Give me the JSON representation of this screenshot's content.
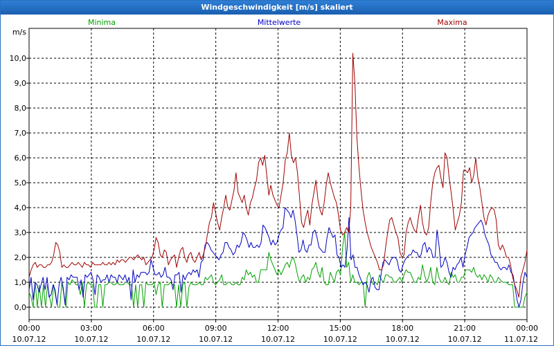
{
  "window": {
    "title": "Windgeschwindigkeit [m/s] skaliert"
  },
  "chart_data": {
    "type": "line",
    "title": "Windgeschwindigkeit [m/s] skaliert",
    "ylabel": "m/s",
    "ylim": [
      -0.5,
      11.2
    ],
    "yticks": [
      "0,0",
      "1,0",
      "2,0",
      "3,0",
      "4,0",
      "5,0",
      "6,0",
      "7,0",
      "8,0",
      "9,0",
      "10,0"
    ],
    "xlim": [
      0,
      24
    ],
    "xticks": [
      {
        "time": "00:00",
        "date": "10.07.12"
      },
      {
        "time": "03:00",
        "date": "10.07.12"
      },
      {
        "time": "06:00",
        "date": "10.07.12"
      },
      {
        "time": "09:00",
        "date": "10.07.12"
      },
      {
        "time": "12:00",
        "date": "10.07.12"
      },
      {
        "time": "15:00",
        "date": "10.07.12"
      },
      {
        "time": "18:00",
        "date": "10.07.12"
      },
      {
        "time": "21:00",
        "date": "10.07.12"
      },
      {
        "time": "00:00",
        "date": "11.07.12"
      }
    ],
    "grid": true,
    "legend_position": "top",
    "sample_interval_hours": 0.1667,
    "series": [
      {
        "name": "Minima",
        "color": "#00a000",
        "values": [
          0.6,
          0.4,
          0.0,
          1.0,
          0.0,
          0.9,
          0.0,
          0.9,
          0.0,
          0.9,
          0.4,
          0.0,
          0.9,
          0.4,
          0.0,
          0.0,
          1.0,
          0.5,
          0.0,
          1.0,
          0.9,
          1.1,
          1.0,
          0.9,
          0.9,
          0.5,
          1.0,
          0.0,
          0.9,
          1.0,
          0.9,
          0.9,
          0.0,
          0.0,
          0.9,
          0.9,
          0.0,
          0.9,
          0.9,
          1.0,
          1.0,
          0.9,
          0.9,
          1.0,
          0.9,
          0.9,
          0.9,
          1.0,
          1.0,
          0.9,
          0.9,
          0.0,
          0.9,
          0.0,
          0.9,
          0.9,
          0.0,
          1.0,
          0.9,
          0.9,
          0.9,
          1.0,
          0.5,
          0.9,
          1.0,
          0.0,
          0.9,
          0.9,
          0.9,
          1.0,
          0.9,
          0.9,
          0.0,
          0.9,
          0.0,
          0.9,
          1.0,
          0.0,
          0.8,
          1.0,
          0.9,
          0.9,
          0.9,
          1.0,
          0.9,
          0.9,
          1.2,
          1.1,
          1.2,
          1.3,
          1.0,
          0.9,
          1.0,
          1.1,
          1.3,
          0.9,
          0.9,
          1.0,
          1.0,
          0.9,
          0.9,
          1.0,
          0.9,
          0.9,
          1.2,
          1.1,
          1.5,
          1.3,
          1.4,
          1.2,
          1.3,
          1.0,
          1.0,
          1.5,
          1.5,
          1.5,
          1.5,
          2.2,
          1.9,
          1.7,
          1.5,
          1.3,
          1.5,
          1.3,
          1.5,
          1.7,
          1.8,
          1.6,
          1.9,
          2.0,
          1.7,
          1.3,
          1.0,
          1.2,
          1.3,
          1.0,
          1.2,
          1.1,
          1.5,
          1.6,
          1.8,
          1.4,
          1.2,
          1.6,
          1.0,
          0.9,
          0.9,
          1.4,
          1.2,
          1.0,
          1.4,
          1.5,
          1.3,
          2.4,
          3.0,
          1.6,
          1.8,
          1.0,
          1.3,
          1.0,
          1.0,
          0.9,
          1.0,
          1.0,
          0.0,
          1.2,
          1.4,
          1.1,
          0.9,
          1.0,
          0.9,
          1.3,
          1.1,
          1.0,
          1.3,
          1.3,
          1.2,
          1.2,
          1.0,
          1.0,
          1.1,
          1.2,
          1.0,
          1.3,
          1.5,
          1.4,
          1.4,
          1.2,
          1.0,
          1.0,
          1.2,
          1.1,
          1.7,
          1.3,
          1.0,
          1.2,
          1.6,
          1.0,
          0.9,
          1.6,
          1.2,
          1.0,
          1.0,
          1.2,
          1.0,
          0.9,
          1.4,
          1.2,
          1.3,
          1.0,
          1.0,
          1.2,
          1.2,
          1.5,
          1.5,
          1.5,
          1.4,
          1.6,
          1.3,
          1.2,
          1.3,
          1.1,
          1.3,
          1.2,
          1.0,
          1.3,
          1.2,
          1.0,
          1.0,
          1.2,
          1.1,
          1.0,
          1.0,
          1.0,
          0.9,
          0.9,
          0.9,
          0.0,
          0.0,
          0.0,
          0.0,
          0.0,
          0.4,
          0.6
        ]
      },
      {
        "name": "Mittelwerte",
        "color": "#0000c0",
        "values": [
          0.7,
          1.2,
          0.3,
          1.0,
          0.9,
          0.6,
          0.9,
          1.2,
          0.7,
          1.2,
          0.4,
          0.5,
          0.9,
          0.7,
          0.1,
          0.9,
          1.2,
          0.8,
          0.1,
          1.2,
          1.1,
          1.3,
          1.2,
          1.2,
          1.2,
          0.7,
          1.1,
          0.4,
          1.3,
          1.2,
          1.3,
          1.4,
          1.1,
          0.5,
          1.3,
          1.2,
          1.0,
          1.1,
          1.1,
          1.3,
          1.0,
          1.3,
          1.2,
          1.2,
          1.0,
          1.3,
          1.2,
          1.1,
          1.3,
          1.0,
          1.2,
          0.3,
          1.5,
          1.0,
          1.3,
          1.2,
          1.4,
          1.4,
          1.4,
          1.3,
          1.4,
          1.9,
          1.6,
          1.3,
          1.3,
          1.4,
          1.2,
          1.3,
          1.6,
          1.2,
          1.2,
          1.1,
          0.7,
          1.3,
          1.3,
          1.4,
          0.6,
          1.3,
          1.1,
          1.3,
          1.4,
          1.3,
          1.5,
          1.4,
          1.5,
          1.2,
          1.8,
          1.9,
          2.5,
          2.6,
          2.5,
          2.3,
          2.2,
          2.1,
          2.0,
          1.9,
          2.1,
          2.2,
          2.6,
          2.6,
          2.4,
          2.3,
          2.1,
          2.2,
          2.5,
          2.4,
          2.6,
          3.0,
          2.9,
          2.7,
          2.4,
          2.6,
          2.4,
          2.4,
          2.5,
          2.4,
          2.6,
          3.3,
          3.2,
          3.0,
          2.8,
          2.5,
          2.7,
          2.5,
          2.6,
          2.9,
          3.1,
          3.2,
          4.0,
          3.9,
          3.8,
          3.6,
          3.9,
          3.5,
          2.9,
          2.2,
          2.3,
          2.7,
          2.3,
          2.2,
          2.5,
          2.5,
          3.0,
          3.1,
          2.8,
          2.4,
          2.3,
          2.2,
          2.2,
          2.8,
          3.2,
          3.0,
          2.8,
          2.9,
          2.1,
          2.0,
          1.6,
          1.7,
          1.6,
          2.3,
          3.6,
          1.9,
          2.1,
          1.6,
          1.6,
          1.3,
          1.1,
          0.9,
          1.0,
          0.9,
          0.6,
          1.1,
          1.2,
          0.8,
          0.7,
          0.7,
          1.3,
          1.8,
          1.9,
          1.8,
          1.7,
          1.9,
          2.0,
          2.0,
          1.9,
          1.5,
          1.4,
          1.7,
          1.9,
          2.0,
          2.1,
          2.1,
          2.3,
          2.2,
          2.2,
          2.0,
          2.1,
          2.5,
          2.6,
          2.2,
          2.4,
          2.3,
          2.0,
          2.0,
          3.1,
          2.5,
          1.6,
          1.7,
          2.0,
          1.8,
          1.4,
          1.2,
          1.6,
          1.5,
          1.7,
          1.8,
          2.0,
          1.6,
          2.1,
          2.4,
          2.8,
          2.9,
          3.0,
          3.2,
          3.3,
          3.4,
          3.5,
          3.3,
          2.9,
          2.7,
          2.5,
          2.1,
          2.0,
          1.8,
          1.8,
          1.6,
          1.5,
          1.6,
          1.6,
          1.5,
          1.7,
          1.4,
          1.3,
          0.8,
          0.3,
          0.0,
          0.3,
          1.0,
          1.4,
          1.2
        ]
      },
      {
        "name": "Maxima",
        "color": "#a00000",
        "values": [
          1.2,
          1.5,
          1.7,
          1.8,
          1.6,
          1.7,
          1.7,
          1.6,
          1.6,
          1.7,
          1.7,
          1.8,
          2.1,
          2.6,
          2.5,
          2.2,
          1.6,
          1.7,
          1.6,
          1.6,
          1.7,
          1.8,
          1.7,
          1.7,
          1.8,
          1.7,
          1.6,
          1.8,
          1.7,
          1.7,
          1.6,
          1.8,
          1.7,
          1.7,
          1.7,
          1.7,
          1.8,
          1.7,
          1.7,
          1.8,
          1.7,
          1.8,
          1.7,
          1.9,
          1.8,
          1.9,
          1.9,
          1.8,
          1.9,
          2.0,
          2.0,
          1.9,
          2.0,
          2.1,
          2.0,
          1.9,
          2.0,
          1.7,
          1.8,
          1.9,
          2.0,
          2.3,
          2.8,
          2.6,
          2.1,
          2.0,
          2.3,
          2.2,
          1.7,
          1.9,
          2.0,
          2.1,
          1.6,
          2.0,
          2.3,
          2.4,
          2.0,
          1.8,
          2.1,
          2.2,
          1.9,
          1.8,
          2.0,
          2.2,
          1.9,
          2.1,
          2.4,
          2.9,
          3.4,
          3.6,
          4.2,
          3.8,
          3.4,
          3.1,
          3.6,
          4.0,
          4.5,
          4.0,
          3.9,
          4.3,
          4.7,
          5.4,
          4.6,
          4.4,
          4.2,
          4.5,
          4.0,
          3.7,
          4.2,
          4.4,
          4.8,
          5.1,
          5.8,
          6.0,
          5.7,
          6.1,
          5.3,
          4.5,
          4.9,
          4.5,
          4.3,
          4.1,
          4.0,
          4.5,
          5.0,
          5.9,
          6.2,
          7.0,
          6.1,
          5.8,
          6.0,
          5.4,
          4.4,
          3.4,
          3.2,
          3.6,
          3.9,
          3.3,
          4.1,
          4.6,
          5.1,
          4.3,
          3.9,
          3.7,
          4.2,
          4.9,
          5.4,
          5.0,
          4.7,
          4.4,
          4.2,
          3.7,
          3.1,
          2.9,
          3.0,
          3.2,
          3.0,
          4.0,
          10.2,
          9.0,
          6.8,
          5.6,
          4.7,
          3.9,
          3.4,
          3.0,
          2.7,
          2.4,
          2.2,
          2.0,
          1.8,
          1.5,
          1.5,
          1.7,
          2.4,
          3.0,
          3.5,
          3.6,
          3.3,
          3.0,
          2.8,
          2.2,
          2.0,
          2.1,
          3.0,
          3.4,
          3.6,
          3.3,
          3.1,
          3.0,
          3.6,
          4.1,
          3.4,
          3.0,
          2.9,
          3.2,
          4.2,
          5.0,
          5.4,
          5.6,
          5.7,
          5.2,
          4.8,
          6.2,
          6.0,
          5.2,
          4.6,
          3.9,
          3.1,
          3.4,
          3.7,
          4.2,
          5.5,
          5.5,
          5.4,
          5.6,
          5.0,
          5.3,
          6.0,
          5.2,
          4.8,
          4.2,
          3.6,
          3.3,
          3.7,
          3.9,
          4.0,
          3.9,
          3.5,
          2.5,
          2.3,
          2.5,
          2.3,
          2.0,
          2.0,
          1.7,
          1.2,
          0.9,
          0.7,
          0.4,
          1.2,
          1.5,
          1.8,
          2.3
        ]
      }
    ]
  }
}
